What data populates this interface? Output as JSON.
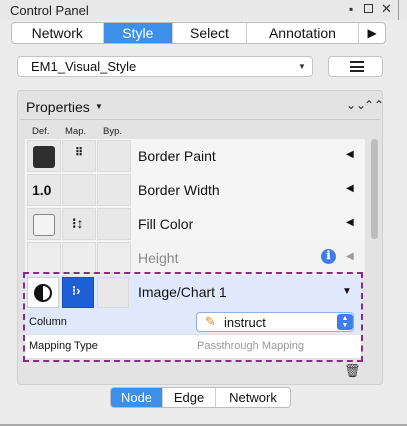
{
  "window": {
    "title": "Control Panel",
    "minimize_glyph": "▪",
    "close_glyph": "✕"
  },
  "top_tabs": {
    "network": "Network",
    "style": "Style",
    "select": "Select",
    "annotation": "Annotation",
    "more_glyph": "▶",
    "active": "Style"
  },
  "style_selector": {
    "value": "EM1_Visual_Style",
    "arrow_glyph": "▼"
  },
  "properties": {
    "title": "Properties",
    "dropdown_glyph": "▼",
    "collapse_glyph": "⌄⌄",
    "expand_glyph": "⌃⌃",
    "columns": {
      "def": "Def.",
      "map": "Map.",
      "byp": "Byp."
    },
    "rows": [
      {
        "label": "Border Paint",
        "def_value": "",
        "arrow": "◀"
      },
      {
        "label": "Border Width",
        "def_value": "1.0",
        "arrow": "◀"
      },
      {
        "label": "Fill Color",
        "def_value": "",
        "arrow": "◀"
      },
      {
        "label": "Height",
        "def_value": "",
        "arrow": "◀",
        "info_glyph": "ℹ"
      }
    ],
    "expanded": {
      "label": "Image/Chart 1",
      "chevron": "▼",
      "column_label": "Column",
      "column_value": "instruct",
      "column_icon_glyph": "✎",
      "stepper_glyph_up": "▲",
      "stepper_glyph_down": "▼",
      "mapping_type_label": "Mapping Type",
      "mapping_type_value": "Passthrough Mapping"
    },
    "trash_glyph": "🗑"
  },
  "bottom_tabs": {
    "node": "Node",
    "edge": "Edge",
    "network": "Network",
    "active": "Node"
  },
  "colors": {
    "accent": "#3d8fe8",
    "highlight_row": "#dfe9fb",
    "dashed_outline": "#8b2a8b",
    "mapping_cell": "#1f5fd6"
  }
}
